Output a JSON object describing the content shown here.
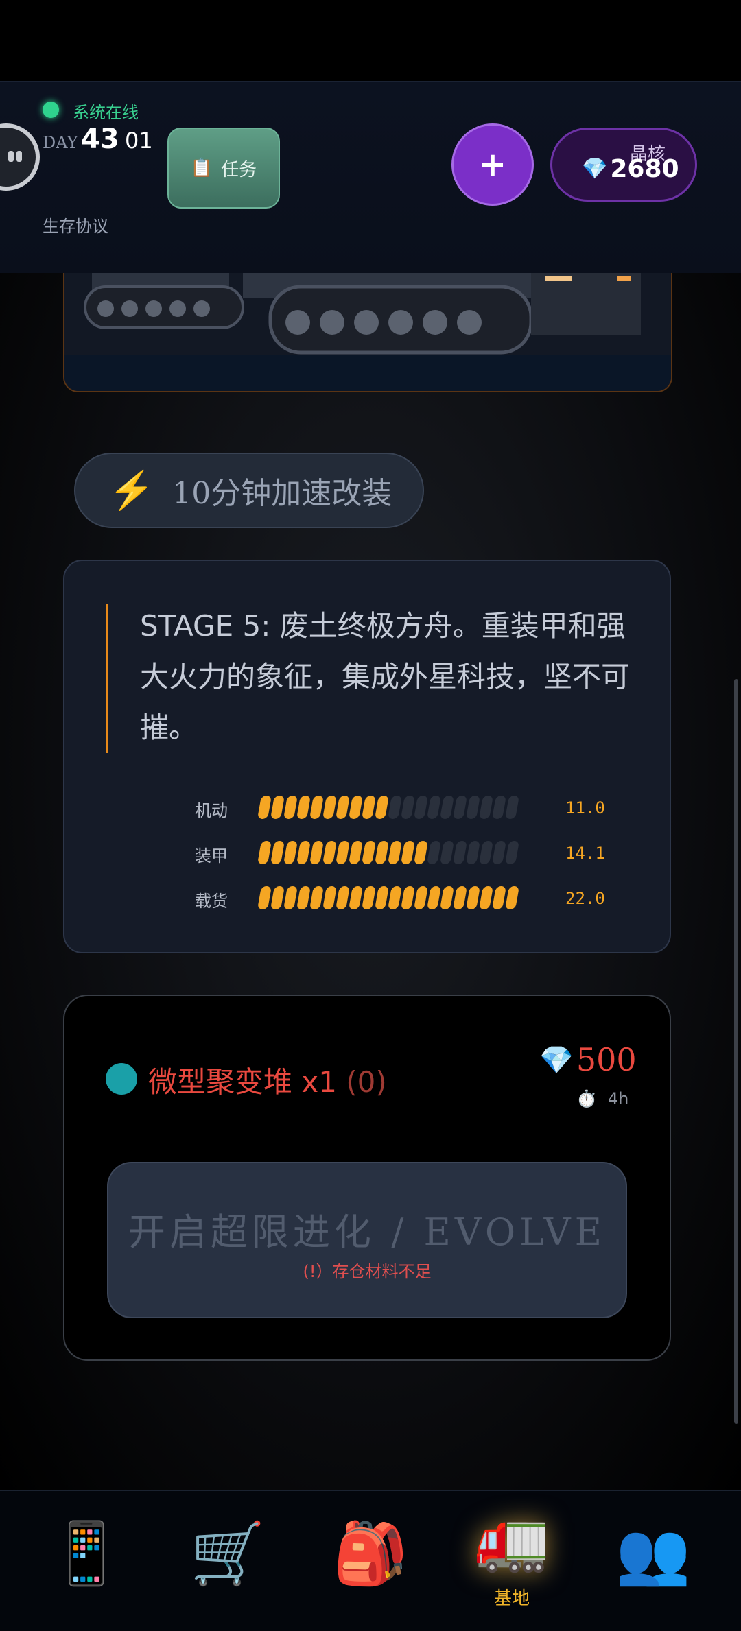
{
  "status": {
    "online_text": "系统在线"
  },
  "header": {
    "day_label": "DAY",
    "day_number": "43",
    "day_sub": "01",
    "protocol": "生存协议",
    "task_icon": "📋",
    "task_label": "任务",
    "plus_label": "+",
    "crystal_label": "晶核",
    "crystal_icon": "💎",
    "crystal_value": "2680"
  },
  "upgrade": {
    "speed_icon": "⚡",
    "speed_label": "10分钟加速改装",
    "stage_text": "STAGE 5: 废土终极方舟。重装甲和强大火力的象征，集成外星科技，坚不可摧。",
    "stats": [
      {
        "label": "机动",
        "value": "11.0",
        "level": 0.5
      },
      {
        "label": "装甲",
        "value": "14.1",
        "level": 0.64
      },
      {
        "label": "载货",
        "value": "22.0",
        "level": 1.0
      }
    ]
  },
  "evolve": {
    "item_name": "微型聚变堆 x1",
    "item_count": "(0)",
    "price_icon": "💎",
    "price_value": "500",
    "time_icon": "⏱️",
    "time_value": "4h",
    "button_label": "开启超限进化 / EVOLVE",
    "warning": "(!）存仓材料不足"
  },
  "nav": {
    "items": [
      {
        "icon": "📱",
        "name": "phone"
      },
      {
        "icon": "🛒",
        "name": "shop"
      },
      {
        "icon": "🎒",
        "name": "backpack"
      },
      {
        "icon": "🚛",
        "name": "base",
        "label": "基地",
        "active": true
      },
      {
        "icon": "👥",
        "name": "social"
      }
    ],
    "active_label": "基地"
  },
  "colors": {
    "accent": "#f5a623",
    "online": "#2fd38e",
    "crystal": "#7b2fc8",
    "danger": "#e9493f"
  }
}
